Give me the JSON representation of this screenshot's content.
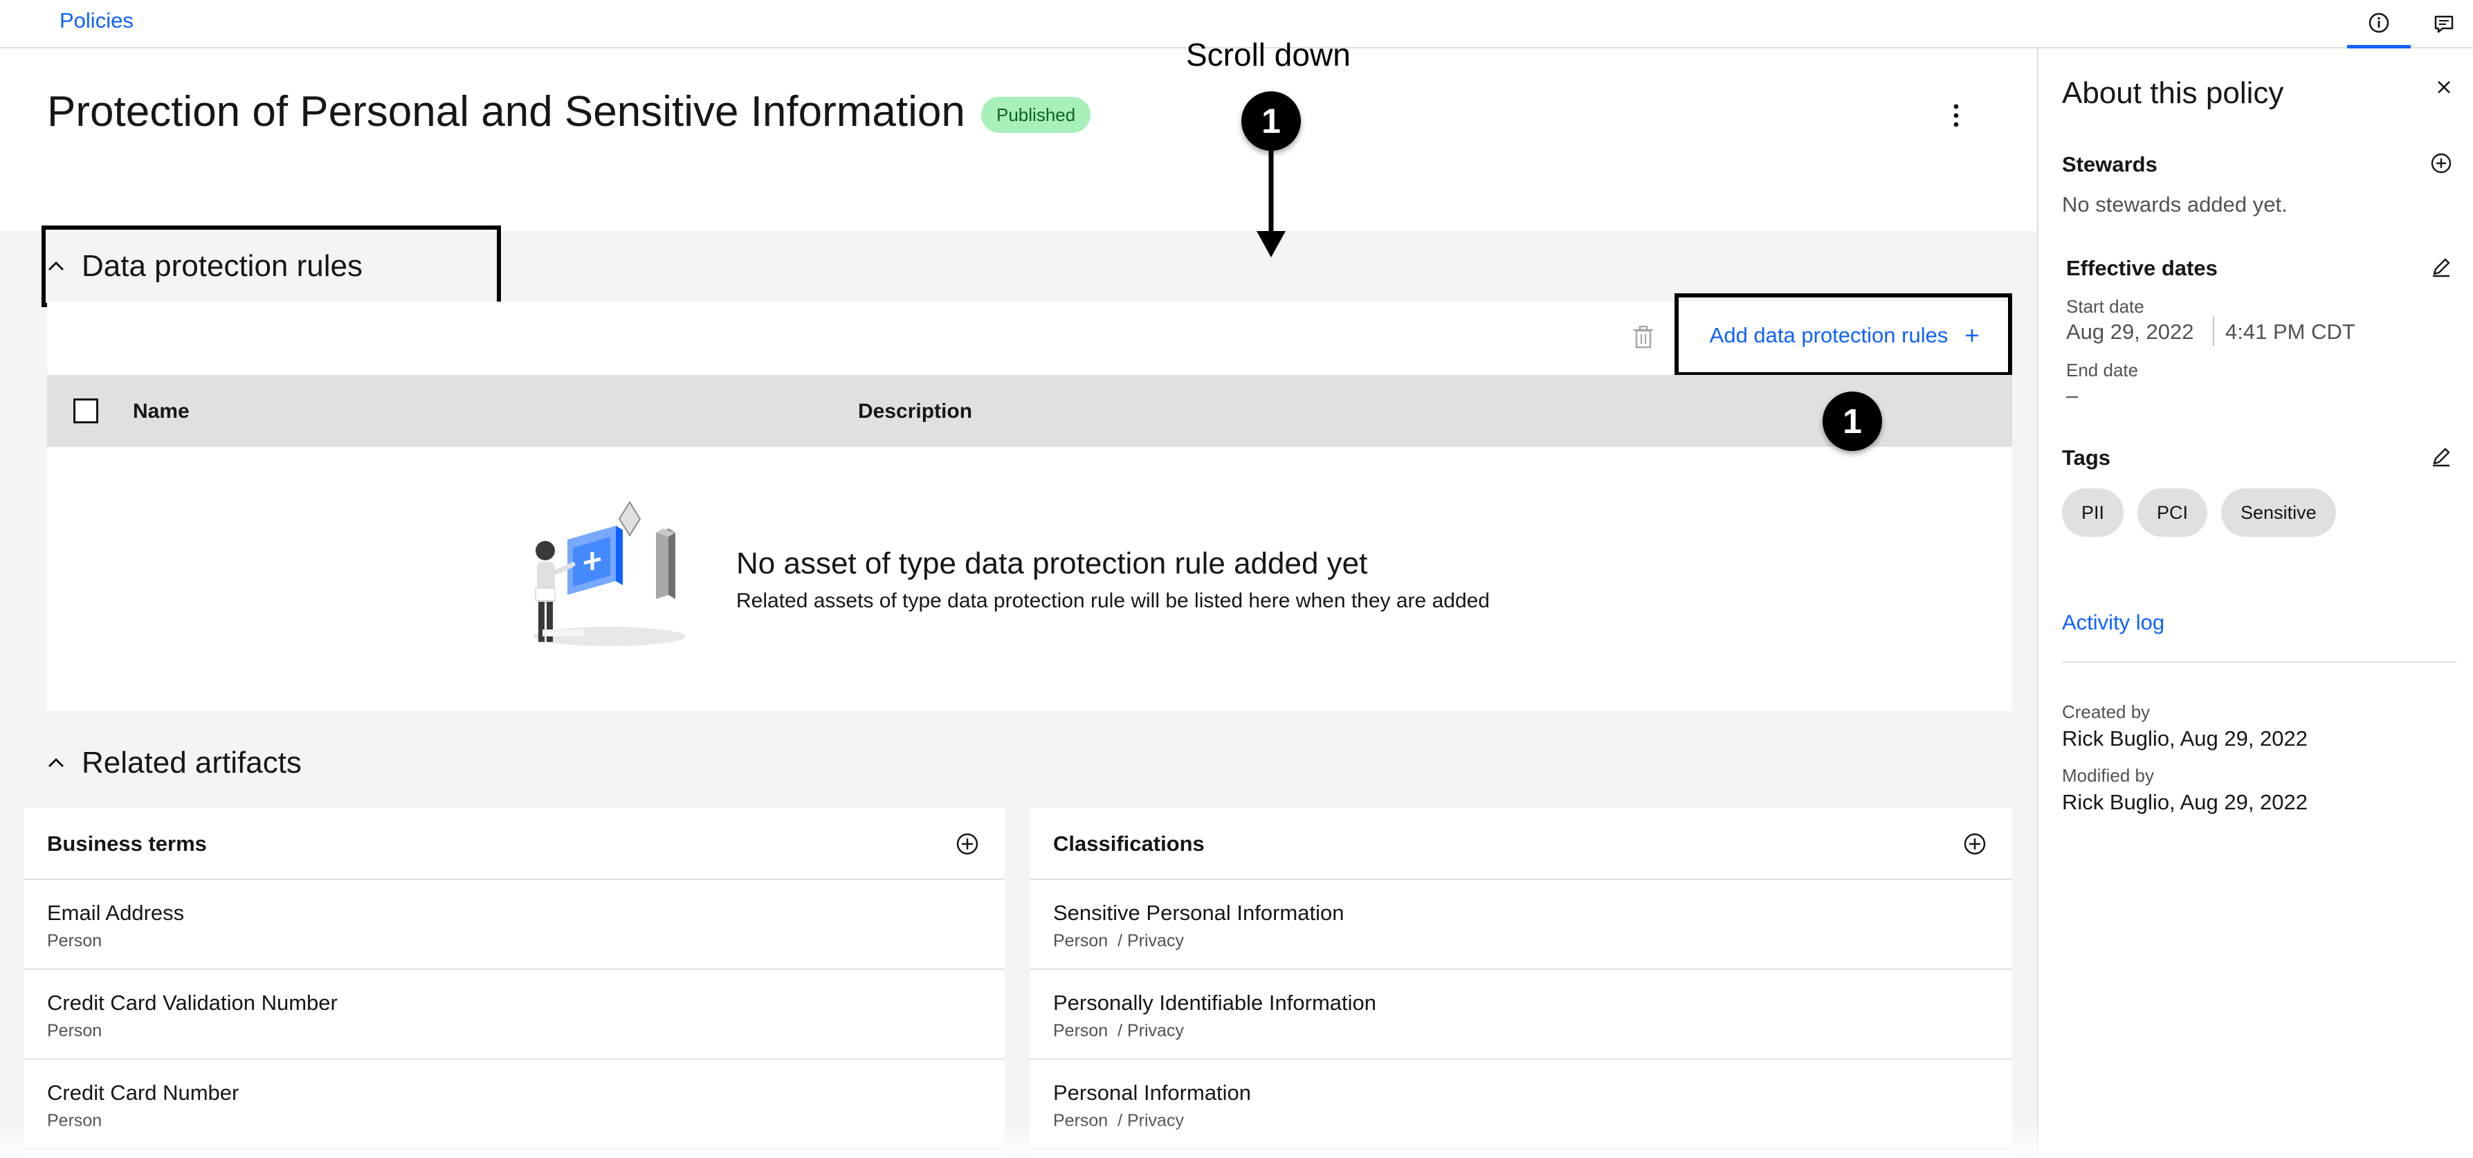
{
  "topbar": {
    "breadcrumb": "Policies",
    "info_tab_icon": "info-icon",
    "comments_tab_icon": "comment-icon"
  },
  "header": {
    "title": "Protection of Personal and Sensitive Information",
    "status": "Published",
    "status_color": "#a7f0ba",
    "overflow_icon": "overflow-menu-vertical-icon"
  },
  "annotations": {
    "scroll_label": "Scroll down",
    "marker_top": "1",
    "marker_add": "1"
  },
  "data_protection": {
    "section_title": "Data protection rules",
    "add_button_label": "Add data protection rules",
    "columns": {
      "name": "Name",
      "description": "Description"
    },
    "empty_title": "No asset of type data protection rule added yet",
    "empty_subtitle": "Related assets of type data protection rule will be listed here when they are added"
  },
  "related_artifacts": {
    "section_title": "Related artifacts",
    "business_terms": {
      "title": "Business terms",
      "items": [
        {
          "name": "Email Address",
          "category": "Person"
        },
        {
          "name": "Credit Card Validation Number",
          "category": "Person"
        },
        {
          "name": "Credit Card Number",
          "category": "Person"
        }
      ]
    },
    "classifications": {
      "title": "Classifications",
      "items": [
        {
          "name": "Sensitive Personal Information",
          "category": "Person  / Privacy"
        },
        {
          "name": "Personally Identifiable Information",
          "category": "Person  / Privacy"
        },
        {
          "name": "Personal Information",
          "category": "Person  / Privacy"
        }
      ]
    }
  },
  "about": {
    "title": "About this policy",
    "stewards_heading": "Stewards",
    "stewards_empty": "No stewards added yet.",
    "effective_heading": "Effective dates",
    "start_label": "Start date",
    "start_date": "Aug 29, 2022",
    "start_time": "4:41 PM CDT",
    "end_label": "End date",
    "end_value": "–",
    "tags_heading": "Tags",
    "tags": [
      "PII",
      "PCI",
      "Sensitive"
    ],
    "activity_log": "Activity log",
    "created_label": "Created by",
    "created_value": "Rick Buglio, Aug 29, 2022",
    "modified_label": "Modified by",
    "modified_value": "Rick Buglio, Aug 29, 2022"
  },
  "colors": {
    "link": "#0f62fe",
    "panel_bg": "#f4f4f4",
    "table_header": "#e0e0e0"
  }
}
